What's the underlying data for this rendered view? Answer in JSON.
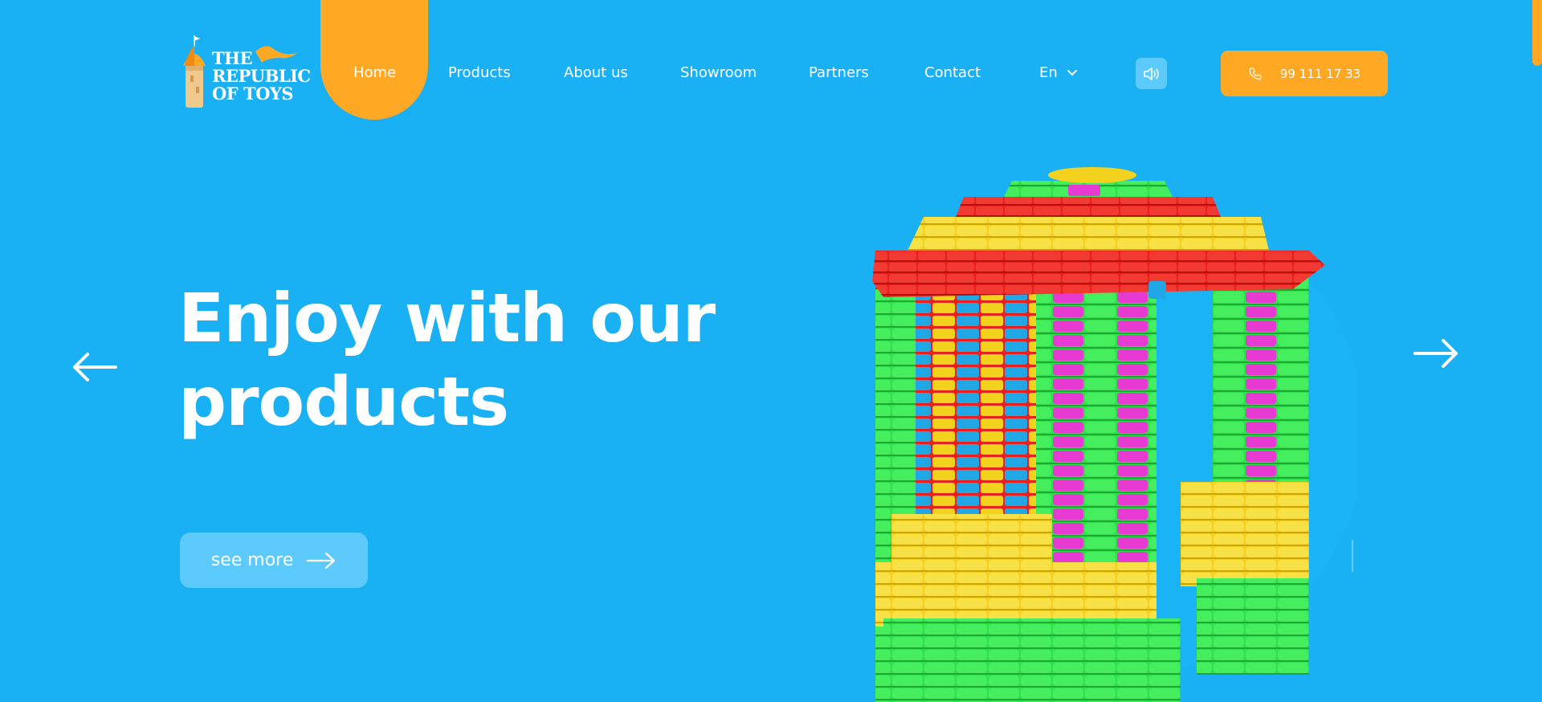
{
  "brand": {
    "logo_lines": [
      "THE",
      "REPUBLIC",
      "OF TOYS"
    ],
    "colors": {
      "background": "#1ab0f4",
      "accent": "#fea823",
      "light_blue": "#5ccbfb",
      "text": "#ffffff"
    }
  },
  "nav": {
    "items": [
      {
        "label": "Home",
        "active": true
      },
      {
        "label": "Products",
        "active": false
      },
      {
        "label": "About us",
        "active": false
      },
      {
        "label": "Showroom",
        "active": false
      },
      {
        "label": "Partners",
        "active": false
      },
      {
        "label": "Contact",
        "active": false
      }
    ],
    "language": {
      "label": "En",
      "icon": "chevron-down-icon"
    },
    "sound_icon": "speaker-icon",
    "phone": {
      "label": "99 111 17 33",
      "icon": "phone-icon"
    }
  },
  "hero": {
    "title_lines": [
      "Enjoy with our",
      "products"
    ],
    "cta_label": "see more",
    "cta_icon": "arrow-right-icon",
    "prev_icon": "arrow-left-icon",
    "next_icon": "arrow-right-icon",
    "image_alt": "building-blocks-toy-house"
  }
}
